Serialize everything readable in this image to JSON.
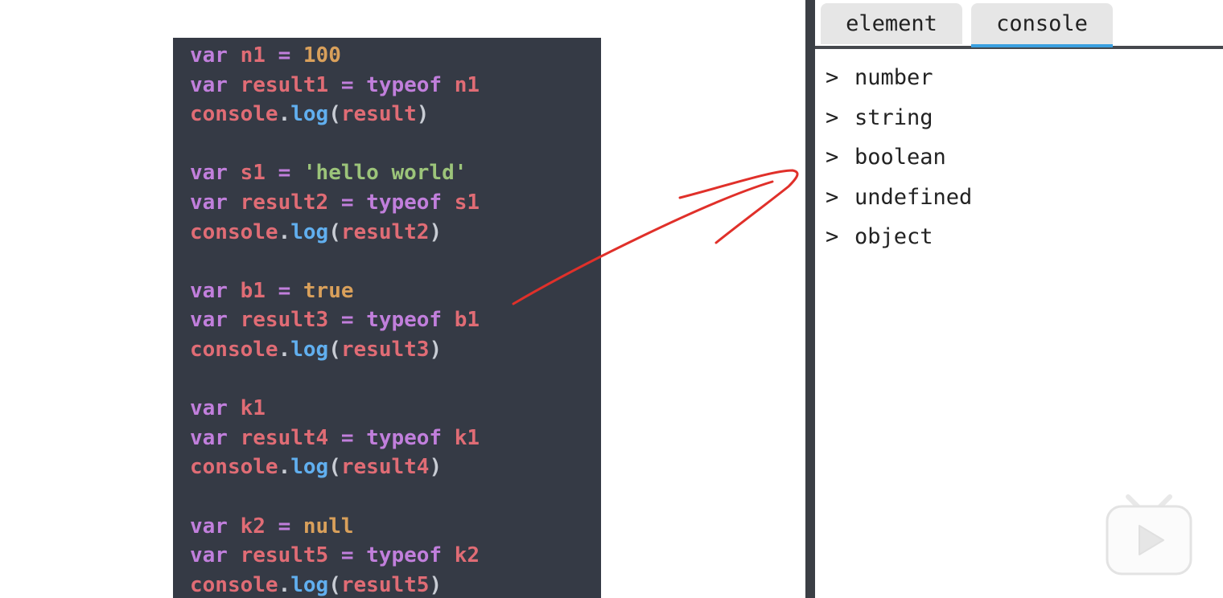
{
  "code": {
    "lines": [
      [
        {
          "t": "var",
          "c": "keyword"
        },
        {
          "t": " n1 ",
          "c": "ident"
        },
        {
          "t": "=",
          "c": "op"
        },
        {
          "t": " 100",
          "c": "number"
        }
      ],
      [
        {
          "t": "var",
          "c": "keyword"
        },
        {
          "t": " result1 ",
          "c": "ident"
        },
        {
          "t": "=",
          "c": "op"
        },
        {
          "t": " typeof",
          "c": "keyword"
        },
        {
          "t": " n1",
          "c": "ident"
        }
      ],
      [
        {
          "t": "console",
          "c": "ident"
        },
        {
          "t": ".",
          "c": "punc"
        },
        {
          "t": "log",
          "c": "method"
        },
        {
          "t": "(",
          "c": "punc"
        },
        {
          "t": "result",
          "c": "ident"
        },
        {
          "t": ")",
          "c": "punc"
        }
      ],
      [],
      [
        {
          "t": "var",
          "c": "keyword"
        },
        {
          "t": " s1 ",
          "c": "ident"
        },
        {
          "t": "=",
          "c": "op"
        },
        {
          "t": " 'hello world'",
          "c": "string"
        }
      ],
      [
        {
          "t": "var",
          "c": "keyword"
        },
        {
          "t": " result2 ",
          "c": "ident"
        },
        {
          "t": "=",
          "c": "op"
        },
        {
          "t": " typeof",
          "c": "keyword"
        },
        {
          "t": " s1",
          "c": "ident"
        }
      ],
      [
        {
          "t": "console",
          "c": "ident"
        },
        {
          "t": ".",
          "c": "punc"
        },
        {
          "t": "log",
          "c": "method"
        },
        {
          "t": "(",
          "c": "punc"
        },
        {
          "t": "result2",
          "c": "ident"
        },
        {
          "t": ")",
          "c": "punc"
        }
      ],
      [],
      [
        {
          "t": "var",
          "c": "keyword"
        },
        {
          "t": " b1 ",
          "c": "ident"
        },
        {
          "t": "=",
          "c": "op"
        },
        {
          "t": " true",
          "c": "number"
        }
      ],
      [
        {
          "t": "var",
          "c": "keyword"
        },
        {
          "t": " result3 ",
          "c": "ident"
        },
        {
          "t": "=",
          "c": "op"
        },
        {
          "t": " typeof",
          "c": "keyword"
        },
        {
          "t": " b1",
          "c": "ident"
        }
      ],
      [
        {
          "t": "console",
          "c": "ident"
        },
        {
          "t": ".",
          "c": "punc"
        },
        {
          "t": "log",
          "c": "method"
        },
        {
          "t": "(",
          "c": "punc"
        },
        {
          "t": "result3",
          "c": "ident"
        },
        {
          "t": ")",
          "c": "punc"
        }
      ],
      [],
      [
        {
          "t": "var",
          "c": "keyword"
        },
        {
          "t": " k1",
          "c": "ident"
        }
      ],
      [
        {
          "t": "var",
          "c": "keyword"
        },
        {
          "t": " result4 ",
          "c": "ident"
        },
        {
          "t": "=",
          "c": "op"
        },
        {
          "t": " typeof",
          "c": "keyword"
        },
        {
          "t": " k1",
          "c": "ident"
        }
      ],
      [
        {
          "t": "console",
          "c": "ident"
        },
        {
          "t": ".",
          "c": "punc"
        },
        {
          "t": "log",
          "c": "method"
        },
        {
          "t": "(",
          "c": "punc"
        },
        {
          "t": "result4",
          "c": "ident"
        },
        {
          "t": ")",
          "c": "punc"
        }
      ],
      [],
      [
        {
          "t": "var",
          "c": "keyword"
        },
        {
          "t": " k2 ",
          "c": "ident"
        },
        {
          "t": "=",
          "c": "op"
        },
        {
          "t": " null",
          "c": "number"
        }
      ],
      [
        {
          "t": "var",
          "c": "keyword"
        },
        {
          "t": " result5 ",
          "c": "ident"
        },
        {
          "t": "=",
          "c": "op"
        },
        {
          "t": " typeof",
          "c": "keyword"
        },
        {
          "t": " k2",
          "c": "ident"
        }
      ],
      [
        {
          "t": "console",
          "c": "ident"
        },
        {
          "t": ".",
          "c": "punc"
        },
        {
          "t": "log",
          "c": "method"
        },
        {
          "t": "(",
          "c": "punc"
        },
        {
          "t": "result5",
          "c": "ident"
        },
        {
          "t": ")",
          "c": "punc"
        }
      ]
    ]
  },
  "devtools": {
    "tabs": {
      "element": "element",
      "console": "console"
    },
    "active_tab": "console",
    "console": {
      "prompt": ">",
      "outputs": [
        "number",
        "string",
        "boolean",
        "undefined",
        "object"
      ]
    }
  },
  "annotation": {
    "arrow_color": "#e0302a"
  },
  "watermark": {
    "icon": "bilibili-tv-play-icon"
  }
}
